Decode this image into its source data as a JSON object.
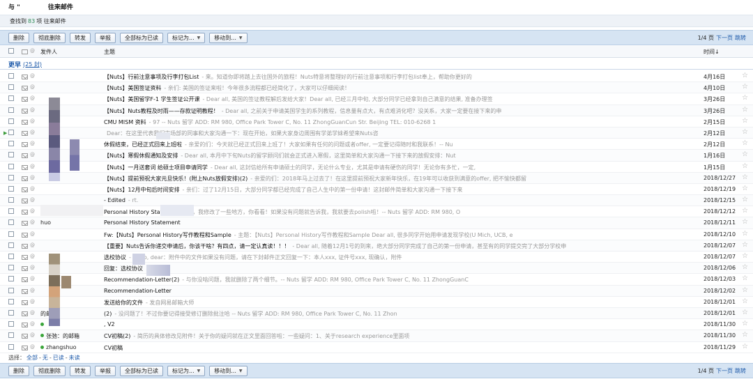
{
  "header": {
    "prefix": "与 \"",
    "title": "往来邮件"
  },
  "search": {
    "prefix": "查找到",
    "count": "83",
    "suffix": "项 往来邮件"
  },
  "toolbar": {
    "buttons": [
      "删除",
      "彻底删除",
      "转发",
      "举报",
      "全部标为已读",
      "标记为...",
      "移动到..."
    ],
    "pager": {
      "page": "1/4 页",
      "next": "下一页",
      "jump": "跳转"
    }
  },
  "columns": {
    "sender": "发件人",
    "subject": "主题",
    "time": "时间↓"
  },
  "group": {
    "title": "更早",
    "count": "(25 封)"
  },
  "rows": [
    {
      "sender": "",
      "subject": "【Nuts】行前注意事项及行李打包List",
      "preview": "- 来。知道你即将踏上去往国外的旅程！Nuts特意将整理好的行前注意事项和行李打包list奉上，帮助你更好的",
      "date": "4月16日"
    },
    {
      "sender": "",
      "subject": "【Nuts】美国签证资料",
      "preview": "- 亲们: 美国的签证来啦！今年很多流程都已经简化了，大家可以仔细阅读！",
      "date": "4月10日"
    },
    {
      "sender": "",
      "subject": "【Nuts】美国留学F-1 学生签证公开课",
      "preview": "- Dear all, 美国的签证教程解后发给大家！Dear all, 已经三月中旬, 大部分同学已经拿到自己满意的结果, 准备办理签",
      "date": "3月26日"
    },
    {
      "sender": "",
      "subject": "【Nuts】Nuts教程及时雨——存款证明教程！",
      "preview": "- Dear all, 之前关于申请美国学生的系列教程，信息量有点大，有点难消化吧？没关系，大家一定要在接下来的申",
      "date": "3月26日"
    },
    {
      "sender": "",
      "subject": "CMU MISM 资料",
      "preview": "- 97 -- Nuts 留学 ADD: RM 980, Office Park Tower C, No. 11 ZhongGuanCun Str. Beijing TEL: 010-6268 1",
      "date": "2月15日"
    },
    {
      "sender": "",
      "subject": "",
      "preview": "Dear：在这里代表我们市场部的同事和大家沟通一下：现在开始，如果大家身边周围有学弟学妹希望来Nuts咨",
      "date": "2月12日"
    },
    {
      "sender": "",
      "subject": "休假结束，已经正式回来上班啦",
      "preview": "- 亲爱的们：今天就已经正式回来上班了！大家如果有任何的问题或者offer, 一定要记得随时和我联系！-- Nu",
      "date": "2月12日"
    },
    {
      "sender": "",
      "subject": "【Nuts】寒假休假通知及安排",
      "preview": "- Dear all, 本月中下旬Nuts的留学顾问们就会正式进入寒假，这里简单和大家沟通一下接下来的放假安排：Nut",
      "date": "1月16日"
    },
    {
      "sender": "",
      "subject": "【Nuts】一月送套词 给硕士项目申请同学",
      "preview": "- Dear all, 这封信给所有申请硕士的同学，无论什么专业，尤其是申请有硬伤的同学！无论你有多忙，一定,",
      "date": "1月15日"
    },
    {
      "sender": "",
      "subject": "【Nuts】提前预祝大家元旦快乐！(附上Nuts放假安排)(2)",
      "preview": "- 亲爱的们：2018年马上过去了！在这里提前预祝大家新年快乐，在19年可以收获到满意的offer, 把不愉快都留",
      "date": "2018/12/27"
    },
    {
      "sender": "",
      "subject": "【Nuts】12月中旬后时间安排",
      "preview": "- 亲们：过了12月15日，大部分同学都已经完成了自己人生中的第一份申请！这封邮件简单和大家沟通一下接下来",
      "date": "2018/12/19"
    },
    {
      "sender": "",
      "subject": "- Edited",
      "preview": "- rt.",
      "date": "2018/12/15"
    },
    {
      "sender": "",
      "subject": "Personal History Statement",
      "preview": "- 亲，我修改了一些地方，你看看！如果没有问题就告诉我，我就要去polish啦！-- Nuts 留学 ADD: RM 980, O",
      "date": "2018/12/12"
    },
    {
      "sender": "huo",
      "subject": "Personal History Statement",
      "preview": "",
      "date": "2018/12/11"
    },
    {
      "sender": "",
      "subject": "Fw:【Nuts】Personal History写作教程和Sample",
      "preview": "- 主题：【Nuts】Personal History写作教程和Sample Dear all, 很多同学开始用申请发现学校(U Mich, UCB, e",
      "date": "2018/12/10"
    },
    {
      "sender": "",
      "subject": "【重要】Nuts告诉你递交申请后，你该干啥？有四点，请一定认真读！！！",
      "preview": "- Dear all, 随着12月1号的到来，绝大部分同学完成了自己的第一份申请，甚至有的同学提交完了大部分学校申",
      "date": "2018/12/07"
    },
    {
      "sender": "",
      "subject": "选校协议",
      "preview": "- Hello, dear：附件中的文件如果没有问题，请在下封邮件正文回复一下：本人xxx, 证件号xxx, 现确认，附件",
      "date": "2018/12/07"
    },
    {
      "sender": "",
      "subject": "回复：选校协议",
      "preview": "",
      "date": "2018/12/06"
    },
    {
      "sender": "",
      "subject": "Recommendation-Letter(2)",
      "preview": "- 与你没啥问题，我就删除了两个细节。-- Nuts 留学 ADD: RM 980, Office Park Tower C, No. 11 ZhongGuanC",
      "date": "2018/12/03"
    },
    {
      "sender": "",
      "subject": "Recommendation-Letter",
      "preview": "",
      "date": "2018/12/02"
    },
    {
      "sender": "",
      "subject": "发送给你的文件",
      "preview": "- 发自网易邮箱大师",
      "date": "2018/12/01"
    },
    {
      "sender": "的邮箱",
      "subject": "(2)",
      "preview": "- 没问题了！不过你要记得接受修订删除批注哈 -- Nuts 留学 ADD: RM 980, Office Park Tower C, No. 11 Zhon",
      "date": "2018/12/01"
    },
    {
      "sender": "",
      "subject": ", V2",
      "preview": "",
      "date": "2018/11/30"
    },
    {
      "sender": "张弛：的邮箱",
      "subject": "CV初稿(2)",
      "preview": "- 简历的具体修改见附件！关于你的疑问就在正文里面回答啦：一些疑问：1、关于research experience里面项",
      "date": "2018/11/30"
    },
    {
      "sender": "zhangshuo",
      "subject": "CV初稿",
      "preview": "",
      "date": "2018/11/29"
    }
  ],
  "selection": {
    "label": "选择：",
    "all": "全部",
    "none": "无",
    "read": "已读",
    "unread": "未读"
  }
}
